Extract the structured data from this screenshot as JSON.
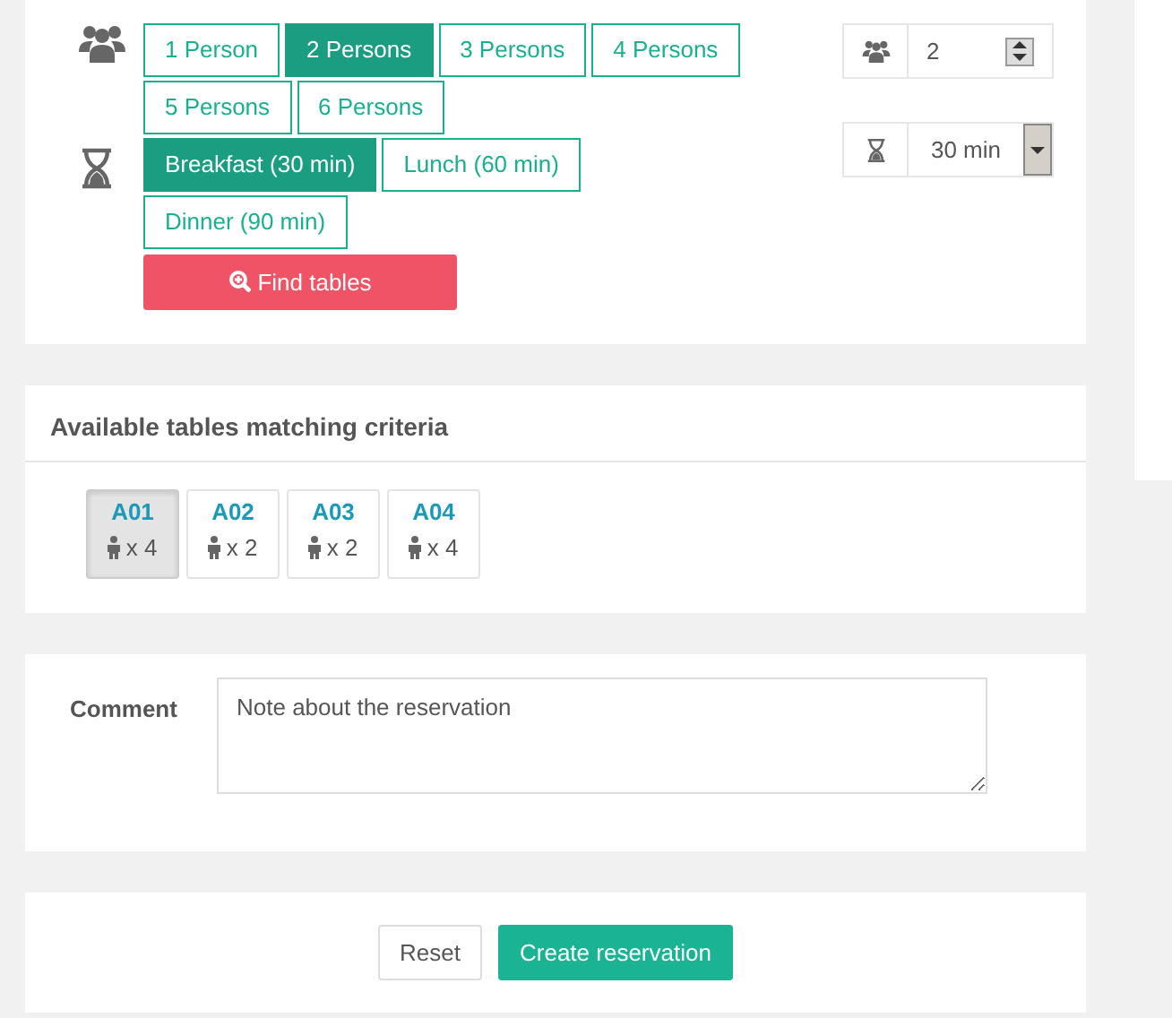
{
  "party": {
    "options": [
      {
        "label": "1 Person",
        "selected": false
      },
      {
        "label": "2 Persons",
        "selected": true
      },
      {
        "label": "3 Persons",
        "selected": false
      },
      {
        "label": "4 Persons",
        "selected": false
      },
      {
        "label": "5 Persons",
        "selected": false
      },
      {
        "label": "6 Persons",
        "selected": false
      }
    ],
    "count": "2"
  },
  "duration": {
    "options": [
      {
        "label": "Breakfast (30 min)",
        "selected": true
      },
      {
        "label": "Lunch (60 min)",
        "selected": false
      },
      {
        "label": "Dinner (90 min)",
        "selected": false
      }
    ],
    "value": "30 min"
  },
  "find_button": "Find tables",
  "tables": {
    "title": "Available tables matching criteria",
    "items": [
      {
        "name": "A01",
        "seats": "x 4",
        "selected": true
      },
      {
        "name": "A02",
        "seats": "x 2",
        "selected": false
      },
      {
        "name": "A03",
        "seats": "x 2",
        "selected": false
      },
      {
        "name": "A04",
        "seats": "x 4",
        "selected": false
      }
    ]
  },
  "comment": {
    "label": "Comment",
    "placeholder": "Note about the reservation"
  },
  "buttons": {
    "reset": "Reset",
    "create": "Create reservation"
  }
}
